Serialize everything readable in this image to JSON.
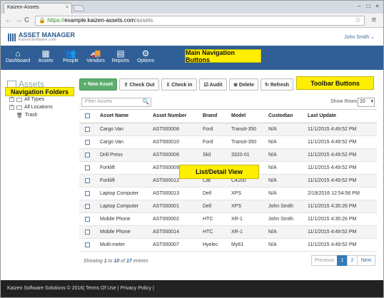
{
  "browser": {
    "tab_title": "Kaizen-Assets",
    "tab_close": "×",
    "window_controls": [
      "–",
      "□",
      "×"
    ],
    "back": "←",
    "forward": "→",
    "reload": "C",
    "url_scheme": "https://",
    "url_host": "example.kaizen-assets.com",
    "url_path": "/assets",
    "menu_icon": "≡"
  },
  "app": {
    "logo_title": "ASSET MANAGER",
    "logo_sub": "KaizenSoftware.com",
    "user": "John Smith ⌄"
  },
  "nav": [
    {
      "label": "Dashboard",
      "icon": "⌂"
    },
    {
      "label": "Assets",
      "icon": "▦"
    },
    {
      "label": "People",
      "icon": "👥"
    },
    {
      "label": "Vendors",
      "icon": "🚚"
    },
    {
      "label": "Reports",
      "icon": "▤"
    },
    {
      "label": "Options",
      "icon": "⚙"
    }
  ],
  "callouts": {
    "main_nav": "Main Navigation Buttons",
    "toolbar": "Toolbar Buttons",
    "folders": "Navigation Folders",
    "list": "List/Detail View"
  },
  "sidebar": {
    "title": "Assets",
    "items": [
      "All Types",
      "All Locations",
      "Trash"
    ]
  },
  "toolbar": {
    "new_asset": "+ New Asset",
    "check_out": "⇪ Check Out",
    "check_in": "⇩ Check In",
    "audit": "☑ Audit",
    "delete": "⊗ Delete",
    "refresh": "↻ Refresh"
  },
  "filter": {
    "placeholder": "Filter Assets",
    "icon": "🔍",
    "show_rows_label": "Show Rows:",
    "rows_value": "10",
    "rows_chevron": "▾"
  },
  "table": {
    "columns": [
      "Asset Name",
      "Asset Number",
      "Brand",
      "Model",
      "Custodian",
      "Last Update"
    ],
    "rows": [
      [
        "Cargo Van",
        "AST000008",
        "Ford",
        "Transit-350",
        "N/A",
        "11/1/2015 4:49:52 PM"
      ],
      [
        "Cargo Van",
        "AST000010",
        "Ford",
        "Transit-350",
        "N/A",
        "11/1/2015 4:49:52 PM"
      ],
      [
        "Drill Press",
        "AST000006",
        "Skil",
        "3320-01",
        "N/A",
        "11/1/2015 4:49:52 PM"
      ],
      [
        "Forklift",
        "AST000009",
        "",
        "",
        "N/A",
        "11/1/2015 4:49:52 PM"
      ],
      [
        "Forklift",
        "AST000012",
        "Cat",
        "C4200",
        "N/A",
        "11/1/2015 4:49:52 PM"
      ],
      [
        "Laptop Computer",
        "AST000013",
        "Dell",
        "XPS",
        "N/A",
        "2/19/2016 12:54:56 PM"
      ],
      [
        "Laptop Computer",
        "AST000001",
        "Dell",
        "XPS",
        "John Smith",
        "11/1/2015 4:35:26 PM"
      ],
      [
        "Mobile Phone",
        "AST000002",
        "HTC",
        "XR-1",
        "John Smith",
        "11/1/2015 4:35:26 PM"
      ],
      [
        "Mobile Phone",
        "AST000014",
        "HTC",
        "XR-1",
        "N/A",
        "11/1/2015 4:49:52 PM"
      ],
      [
        "Multi-meter",
        "AST000007",
        "Hyelec",
        "My61",
        "N/A",
        "11/1/2015 4:49:52 PM"
      ]
    ]
  },
  "showing": {
    "prefix": "Showing ",
    "from": "1",
    "to_word": " to ",
    "to": "10",
    "of_word": " of ",
    "total": "17",
    "suffix": " entries"
  },
  "pager": {
    "previous": "Previous",
    "pages": [
      "1",
      "2"
    ],
    "next": "Next"
  },
  "footer": "Kaizen Software Solutions © 2016| Terms Of Use | Privacy Policy |"
}
